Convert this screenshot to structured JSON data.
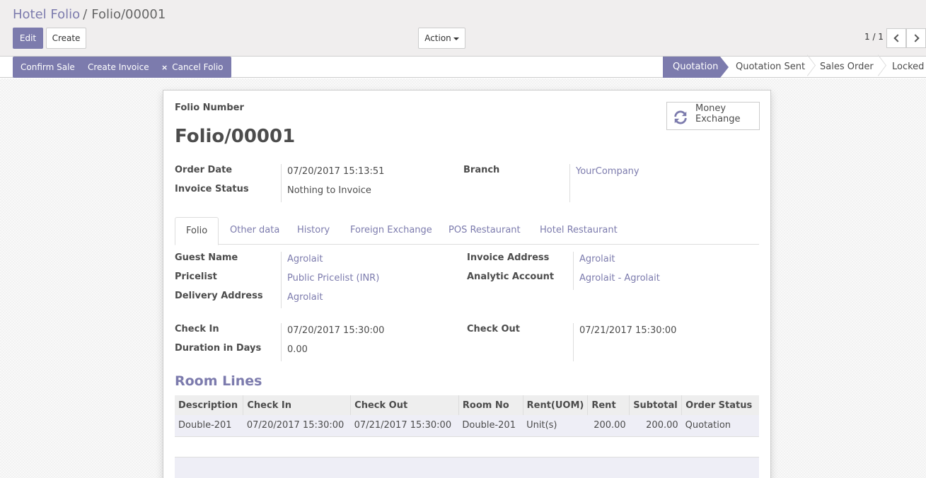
{
  "breadcrumb": {
    "parent": "Hotel Folio",
    "separator": "/",
    "current": "Folio/00001"
  },
  "toolbar": {
    "edit_label": "Edit",
    "create_label": "Create",
    "action_label": "Action"
  },
  "pager": {
    "value": "1 / 1"
  },
  "statusbar": {
    "buttons": [
      "Confirm Sale",
      "Create Invoice",
      "Cancel Folio"
    ],
    "cancel_icon": "×",
    "stages": [
      "Quotation",
      "Quotation Sent",
      "Sales Order",
      "Locked"
    ],
    "active_stage": "Quotation"
  },
  "colors": {
    "accent": "#7c7bad",
    "row_bg": "#eeeef6"
  },
  "form": {
    "number_label": "Folio Number",
    "number": "Folio/00001",
    "smart_button": {
      "line1": "Money",
      "line2": "Exchange",
      "icon": "refresh-icon"
    },
    "order_date_label": "Order Date",
    "order_date": "07/20/2017 15:13:51",
    "invoice_status_label": "Invoice Status",
    "invoice_status": "Nothing to Invoice",
    "branch_label": "Branch",
    "branch": "YourCompany"
  },
  "tabs": [
    "Folio",
    "Other data",
    "History",
    "Foreign Exchange",
    "POS Restaurant",
    "Hotel Restaurant"
  ],
  "folio": {
    "guest_name_label": "Guest Name",
    "guest_name": "Agrolait",
    "pricelist_label": "Pricelist",
    "pricelist": "Public Pricelist (INR)",
    "delivery_label": "Delivery Address",
    "delivery": "Agrolait",
    "invoice_address_label": "Invoice Address",
    "invoice_address": "Agrolait",
    "analytic_label": "Analytic Account",
    "analytic": "Agrolait - Agrolait",
    "check_in_label": "Check In",
    "check_in": "07/20/2017 15:30:00",
    "duration_label": "Duration in Days",
    "duration": "0.00",
    "check_out_label": "Check Out",
    "check_out": "07/21/2017 15:30:00"
  },
  "room_lines": {
    "title": "Room Lines",
    "headers": [
      "Description",
      "Check In",
      "Check Out",
      "Room No",
      "Rent(UOM)",
      "Rent",
      "Subtotal",
      "Order Status"
    ],
    "rows": [
      [
        "Double-201",
        "07/20/2017 15:30:00",
        "07/21/2017 15:30:00",
        "Double-201",
        "Unit(s)",
        "200.00",
        "200.00",
        "Quotation"
      ]
    ]
  }
}
